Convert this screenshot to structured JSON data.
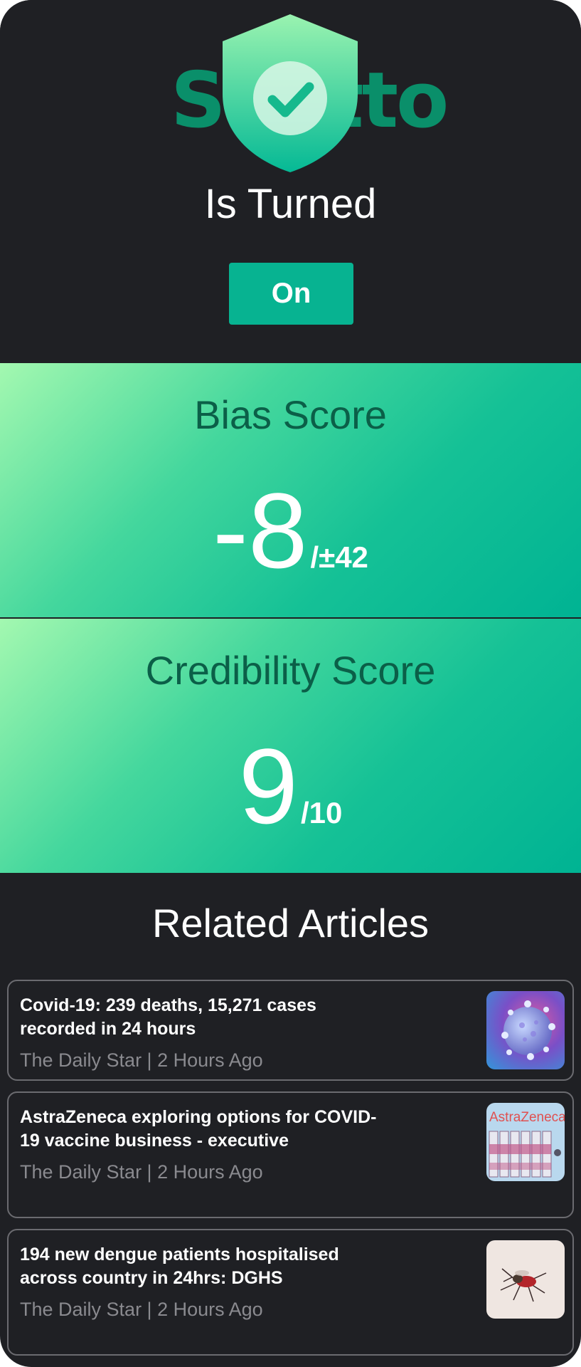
{
  "header": {
    "logo_text": "Shotto",
    "status_label": "Is Turned",
    "toggle_label": "On"
  },
  "bias": {
    "title": "Bias Score",
    "value": "-8",
    "suffix": "/±42"
  },
  "credibility": {
    "title": "Credibility Score",
    "value": "9",
    "suffix": "/10"
  },
  "related": {
    "title": "Related Articles",
    "articles": [
      {
        "title": "Covid-19: 239 deaths, 15,271 cases recorded in 24 hours",
        "source": "The Daily Star | 2 Hours Ago",
        "thumbnail": "virus-image"
      },
      {
        "title": "AstraZeneca exploring options for COVID-19 vaccine business - executive",
        "source": "The Daily Star | 2 Hours Ago",
        "thumbnail": "vaccine-vials-image",
        "thumbnail_text": "AstraZeneca"
      },
      {
        "title": "194 new dengue patients hospitalised across country in 24hrs: DGHS",
        "source": "The Daily Star | 2 Hours Ago",
        "thumbnail": "mosquito-image"
      }
    ]
  },
  "colors": {
    "background": "#1f2024",
    "accent": "#07b391",
    "gradient_start": "#a3f8b0",
    "gradient_end": "#00b393",
    "score_title": "#0b5f48"
  }
}
